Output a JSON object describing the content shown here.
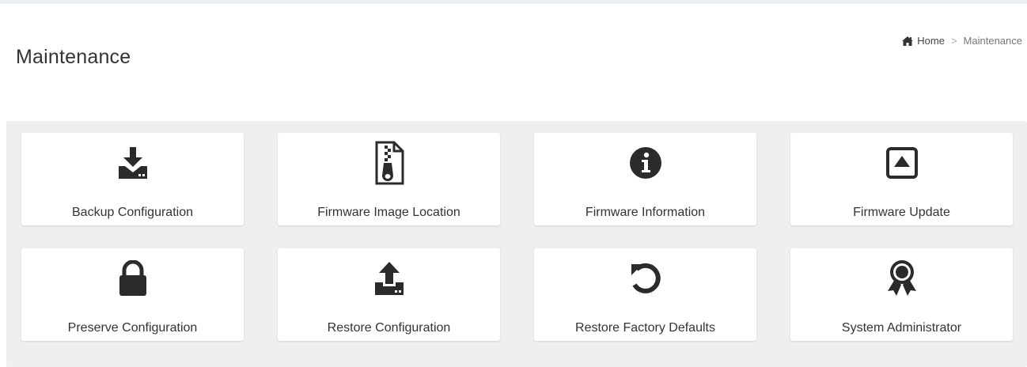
{
  "header": {
    "title": "Maintenance"
  },
  "breadcrumb": {
    "home_icon": "home-icon",
    "home": "Home",
    "separator": ">",
    "current": "Maintenance"
  },
  "tiles": [
    {
      "label": "Backup Configuration",
      "icon": "download-drive-icon"
    },
    {
      "label": "Firmware Image Location",
      "icon": "zip-file-icon"
    },
    {
      "label": "Firmware Information",
      "icon": "info-circle-icon"
    },
    {
      "label": "Firmware Update",
      "icon": "eject-square-icon"
    },
    {
      "label": "Preserve Configuration",
      "icon": "lock-icon"
    },
    {
      "label": "Restore Configuration",
      "icon": "upload-drive-icon"
    },
    {
      "label": "Restore Factory Defaults",
      "icon": "undo-icon"
    },
    {
      "label": "System Administrator",
      "icon": "award-icon"
    }
  ],
  "colors": {
    "icon": "#2b2b2b",
    "panel_background": "#efefef",
    "tile_background": "#ffffff"
  }
}
